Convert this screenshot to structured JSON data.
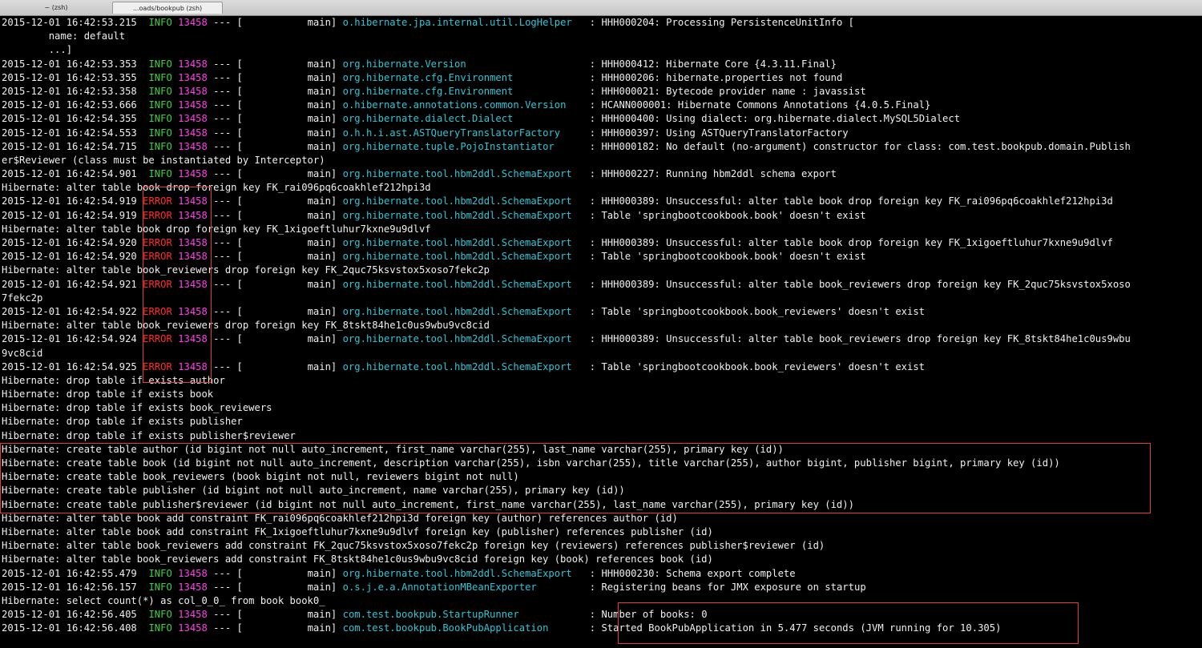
{
  "tabs": [
    "~ (zsh)",
    "...oads/bookpub (zsh)"
  ],
  "colors": {
    "info": "#3ed140",
    "error": "#ff2b2b",
    "pid": "#ff3fe6",
    "logger": "#2ec6d6",
    "highlight": "#e53a3a"
  },
  "lines": [
    {
      "ts": "2015-12-01 16:42:53.215",
      "level": "INFO",
      "pid": "13458",
      "thread": "[           main] ",
      "logger": "o.hibernate.jpa.internal.util.LogHelper  ",
      "msg": ": HHH000204: Processing PersistenceUnitInfo ["
    },
    {
      "text": "        name: default"
    },
    {
      "text": "        ...]"
    },
    {
      "ts": "2015-12-01 16:42:53.353",
      "level": "INFO",
      "pid": "13458",
      "thread": "[           main] ",
      "logger": "org.hibernate.Version                    ",
      "msg": ": HHH000412: Hibernate Core {4.3.11.Final}"
    },
    {
      "ts": "2015-12-01 16:42:53.355",
      "level": "INFO",
      "pid": "13458",
      "thread": "[           main] ",
      "logger": "org.hibernate.cfg.Environment            ",
      "msg": ": HHH000206: hibernate.properties not found"
    },
    {
      "ts": "2015-12-01 16:42:53.358",
      "level": "INFO",
      "pid": "13458",
      "thread": "[           main] ",
      "logger": "org.hibernate.cfg.Environment            ",
      "msg": ": HHH000021: Bytecode provider name : javassist"
    },
    {
      "ts": "2015-12-01 16:42:53.666",
      "level": "INFO",
      "pid": "13458",
      "thread": "[           main] ",
      "logger": "o.hibernate.annotations.common.Version   ",
      "msg": ": HCANN000001: Hibernate Commons Annotations {4.0.5.Final}"
    },
    {
      "ts": "2015-12-01 16:42:54.355",
      "level": "INFO",
      "pid": "13458",
      "thread": "[           main] ",
      "logger": "org.hibernate.dialect.Dialect            ",
      "msg": ": HHH000400: Using dialect: org.hibernate.dialect.MySQL5Dialect"
    },
    {
      "ts": "2015-12-01 16:42:54.553",
      "level": "INFO",
      "pid": "13458",
      "thread": "[           main] ",
      "logger": "o.h.h.i.ast.ASTQueryTranslatorFactory    ",
      "msg": ": HHH000397: Using ASTQueryTranslatorFactory"
    },
    {
      "ts": "2015-12-01 16:42:54.715",
      "level": "INFO",
      "pid": "13458",
      "thread": "[           main] ",
      "logger": "org.hibernate.tuple.PojoInstantiator     ",
      "msg": ": HHH000182: No default (no-argument) constructor for class: com.test.bookpub.domain.Publish"
    },
    {
      "text": "er$Reviewer (class must be instantiated by Interceptor)"
    },
    {
      "ts": "2015-12-01 16:42:54.901",
      "level": "INFO",
      "pid": "13458",
      "thread": "[           main] ",
      "logger": "org.hibernate.tool.hbm2ddl.SchemaExport  ",
      "msg": ": HHH000227: Running hbm2ddl schema export"
    },
    {
      "text": "Hibernate: alter table book drop foreign key FK_rai096pq6coakhlef212hpi3d"
    },
    {
      "ts": "2015-12-01 16:42:54.919",
      "level": "ERROR",
      "pid": "13458",
      "thread": "[           main] ",
      "logger": "org.hibernate.tool.hbm2ddl.SchemaExport  ",
      "msg": ": HHH000389: Unsuccessful: alter table book drop foreign key FK_rai096pq6coakhlef212hpi3d"
    },
    {
      "ts": "2015-12-01 16:42:54.919",
      "level": "ERROR",
      "pid": "13458",
      "thread": "[           main] ",
      "logger": "org.hibernate.tool.hbm2ddl.SchemaExport  ",
      "msg": ": Table 'springbootcookbook.book' doesn't exist"
    },
    {
      "text": "Hibernate: alter table book drop foreign key FK_1xigoeftluhur7kxne9u9dlvf"
    },
    {
      "ts": "2015-12-01 16:42:54.920",
      "level": "ERROR",
      "pid": "13458",
      "thread": "[           main] ",
      "logger": "org.hibernate.tool.hbm2ddl.SchemaExport  ",
      "msg": ": HHH000389: Unsuccessful: alter table book drop foreign key FK_1xigoeftluhur7kxne9u9dlvf"
    },
    {
      "ts": "2015-12-01 16:42:54.920",
      "level": "ERROR",
      "pid": "13458",
      "thread": "[           main] ",
      "logger": "org.hibernate.tool.hbm2ddl.SchemaExport  ",
      "msg": ": Table 'springbootcookbook.book' doesn't exist"
    },
    {
      "text": "Hibernate: alter table book_reviewers drop foreign key FK_2quc75ksvstox5xoso7fekc2p"
    },
    {
      "ts": "2015-12-01 16:42:54.921",
      "level": "ERROR",
      "pid": "13458",
      "thread": "[           main] ",
      "logger": "org.hibernate.tool.hbm2ddl.SchemaExport  ",
      "msg": ": HHH000389: Unsuccessful: alter table book_reviewers drop foreign key FK_2quc75ksvstox5xoso"
    },
    {
      "text": "7fekc2p"
    },
    {
      "ts": "2015-12-01 16:42:54.922",
      "level": "ERROR",
      "pid": "13458",
      "thread": "[           main] ",
      "logger": "org.hibernate.tool.hbm2ddl.SchemaExport  ",
      "msg": ": Table 'springbootcookbook.book_reviewers' doesn't exist"
    },
    {
      "text": "Hibernate: alter table book_reviewers drop foreign key FK_8tskt84he1c0us9wbu9vc8cid"
    },
    {
      "ts": "2015-12-01 16:42:54.924",
      "level": "ERROR",
      "pid": "13458",
      "thread": "[           main] ",
      "logger": "org.hibernate.tool.hbm2ddl.SchemaExport  ",
      "msg": ": HHH000389: Unsuccessful: alter table book_reviewers drop foreign key FK_8tskt84he1c0us9wbu"
    },
    {
      "text": "9vc8cid"
    },
    {
      "ts": "2015-12-01 16:42:54.925",
      "level": "ERROR",
      "pid": "13458",
      "thread": "[           main] ",
      "logger": "org.hibernate.tool.hbm2ddl.SchemaExport  ",
      "msg": ": Table 'springbootcookbook.book_reviewers' doesn't exist"
    },
    {
      "text": "Hibernate: drop table if exists author"
    },
    {
      "text": "Hibernate: drop table if exists book"
    },
    {
      "text": "Hibernate: drop table if exists book_reviewers"
    },
    {
      "text": "Hibernate: drop table if exists publisher"
    },
    {
      "text": "Hibernate: drop table if exists publisher$reviewer"
    },
    {
      "text": "Hibernate: create table author (id bigint not null auto_increment, first_name varchar(255), last_name varchar(255), primary key (id))"
    },
    {
      "text": "Hibernate: create table book (id bigint not null auto_increment, description varchar(255), isbn varchar(255), title varchar(255), author bigint, publisher bigint, primary key (id))"
    },
    {
      "text": "Hibernate: create table book_reviewers (book bigint not null, reviewers bigint not null)"
    },
    {
      "text": "Hibernate: create table publisher (id bigint not null auto_increment, name varchar(255), primary key (id))"
    },
    {
      "text": "Hibernate: create table publisher$reviewer (id bigint not null auto_increment, first_name varchar(255), last_name varchar(255), primary key (id))"
    },
    {
      "text": "Hibernate: alter table book add constraint FK_rai096pq6coakhlef212hpi3d foreign key (author) references author (id)"
    },
    {
      "text": "Hibernate: alter table book add constraint FK_1xigoeftluhur7kxne9u9dlvf foreign key (publisher) references publisher (id)"
    },
    {
      "text": "Hibernate: alter table book_reviewers add constraint FK_2quc75ksvstox5xoso7fekc2p foreign key (reviewers) references publisher$reviewer (id)"
    },
    {
      "text": "Hibernate: alter table book_reviewers add constraint FK_8tskt84he1c0us9wbu9vc8cid foreign key (book) references book (id)"
    },
    {
      "ts": "2015-12-01 16:42:55.479",
      "level": "INFO",
      "pid": "13458",
      "thread": "[           main] ",
      "logger": "org.hibernate.tool.hbm2ddl.SchemaExport  ",
      "msg": ": HHH000230: Schema export complete"
    },
    {
      "ts": "2015-12-01 16:42:56.157",
      "level": "INFO",
      "pid": "13458",
      "thread": "[           main] ",
      "logger": "o.s.j.e.a.AnnotationMBeanExporter        ",
      "msg": ": Registering beans for JMX exposure on startup"
    },
    {
      "text": "Hibernate: select count(*) as col_0_0_ from book book0_"
    },
    {
      "ts": "2015-12-01 16:42:56.405",
      "level": "INFO",
      "pid": "13458",
      "thread": "[           main] ",
      "logger": "com.test.bookpub.StartupRunner           ",
      "msg": ": Number of books: 0"
    },
    {
      "ts": "2015-12-01 16:42:56.408",
      "level": "INFO",
      "pid": "13458",
      "thread": "[           main] ",
      "logger": "com.test.bookpub.BookPubApplication      ",
      "msg": ": Started BookPubApplication in 5.477 seconds (JVM running for 10.305)"
    }
  ]
}
